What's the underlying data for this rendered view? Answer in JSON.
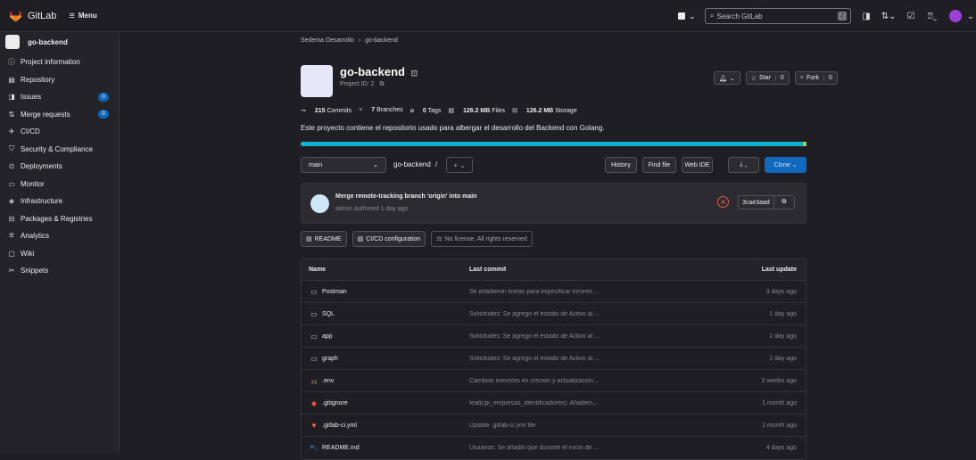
{
  "topbar": {
    "brand": "GitLab",
    "menu_label": "Menu",
    "search_placeholder": "Search GitLab",
    "search_shortcut": "/"
  },
  "sidebar": {
    "project": "go-backend",
    "items": [
      {
        "label": "Project information",
        "icon": "info-icon",
        "glyph": "ⓘ"
      },
      {
        "label": "Repository",
        "icon": "document-icon",
        "glyph": "▤"
      },
      {
        "label": "Issues",
        "icon": "issues-icon",
        "glyph": "◨",
        "badge": "0"
      },
      {
        "label": "Merge requests",
        "icon": "merge-request-icon",
        "glyph": "⇅",
        "badge": "0"
      },
      {
        "label": "CI/CD",
        "icon": "rocket-icon",
        "glyph": "✈"
      },
      {
        "label": "Security & Compliance",
        "icon": "shield-icon",
        "glyph": "⛉"
      },
      {
        "label": "Deployments",
        "icon": "deployments-icon",
        "glyph": "⊙"
      },
      {
        "label": "Monitor",
        "icon": "monitor-icon",
        "glyph": "▭"
      },
      {
        "label": "Infrastructure",
        "icon": "cloud-icon",
        "glyph": "◈"
      },
      {
        "label": "Packages & Registries",
        "icon": "package-icon",
        "glyph": "⊟"
      },
      {
        "label": "Analytics",
        "icon": "chart-icon",
        "glyph": "≝"
      },
      {
        "label": "Wiki",
        "icon": "book-icon",
        "glyph": "▢"
      },
      {
        "label": "Snippets",
        "icon": "scissors-icon",
        "glyph": "✂"
      }
    ]
  },
  "breadcrumb": {
    "group": "Sedema Desarrollo",
    "sep": "›",
    "project": "go-backend"
  },
  "project": {
    "name": "go-backend",
    "id_text": "Project ID: 2",
    "notify_label": "⌂",
    "star_label": "Star",
    "star_count": "0",
    "fork_label": "Fork",
    "fork_count": "0",
    "description": "Este proyecto contiene el repositorio usado para albergar el desarrollo del Backend con Golang."
  },
  "stats": {
    "commits_count": "215",
    "commits_label": "Commits",
    "branches_count": "7",
    "branches_label": "Branches",
    "tags_count": "0",
    "tags_label": "Tags",
    "files_size": "126.2 MB",
    "files_label": "Files",
    "storage_size": "126.2 MB",
    "storage_label": "Storage"
  },
  "filebar": {
    "branch": "main",
    "path": "go-backend",
    "path_sep": "/",
    "add": "+ ⌄",
    "history": "History",
    "find_file": "Find file",
    "web_ide": "Web IDE",
    "download": "⤓ ⌄",
    "clone": "Clone ⌄"
  },
  "commit": {
    "message": "Merge remote-tracking branch 'origin' into main",
    "meta": "admin authored 1 day ago",
    "sha": "3cae3aad"
  },
  "tags": {
    "readme": "README",
    "cicd": "CI/CD configuration",
    "license": "No license. All rights reserved"
  },
  "table": {
    "headers": {
      "name": "Name",
      "last_commit": "Last commit",
      "last_update": "Last update"
    },
    "rows": [
      {
        "name": "Postman",
        "icon": "folder-icon",
        "glyph": "▭",
        "commit": "Se añadieron líneas para especificar errores ...",
        "updated": "3 days ago"
      },
      {
        "name": "SQL",
        "icon": "folder-icon",
        "glyph": "▭",
        "commit": "Solicitudes: Se agrego el estado de Activo al ...",
        "updated": "1 day ago"
      },
      {
        "name": "app",
        "icon": "folder-icon",
        "glyph": "▭",
        "commit": "Solicitudes: Se agrego el estado de Activo al ...",
        "updated": "1 day ago"
      },
      {
        "name": "graph",
        "icon": "folder-icon",
        "glyph": "▭",
        "commit": "Solicitudes: Se agrego el estado de Activo al ...",
        "updated": "1 day ago"
      },
      {
        "name": ".env",
        "icon": "env-file-icon",
        "glyph": "⚏",
        "commit": "Cambios menores en creción y actualización...",
        "updated": "2 weeks ago"
      },
      {
        "name": ".gitignore",
        "icon": "git-icon",
        "glyph": "◆",
        "commit": "feat(cpi_empresas_identificadores): Añadien...",
        "updated": "1 month ago"
      },
      {
        "name": ".gitlab-ci.yml",
        "icon": "gitlab-icon",
        "glyph": "▼",
        "commit": "Update .gitlab-ci.yml file",
        "updated": "1 month ago"
      },
      {
        "name": "README.md",
        "icon": "markdown-icon",
        "glyph": "ᴹ↓",
        "commit": "Usuarios: Se añadió que durante el inicio de ...",
        "updated": "4 days ago"
      }
    ]
  },
  "colors": {
    "background": "#1f1e24",
    "sidebar": "#24232a",
    "accent": "#1068bf",
    "language_bar": "#0eb1d0",
    "pipeline_failed": "#ec5941"
  }
}
